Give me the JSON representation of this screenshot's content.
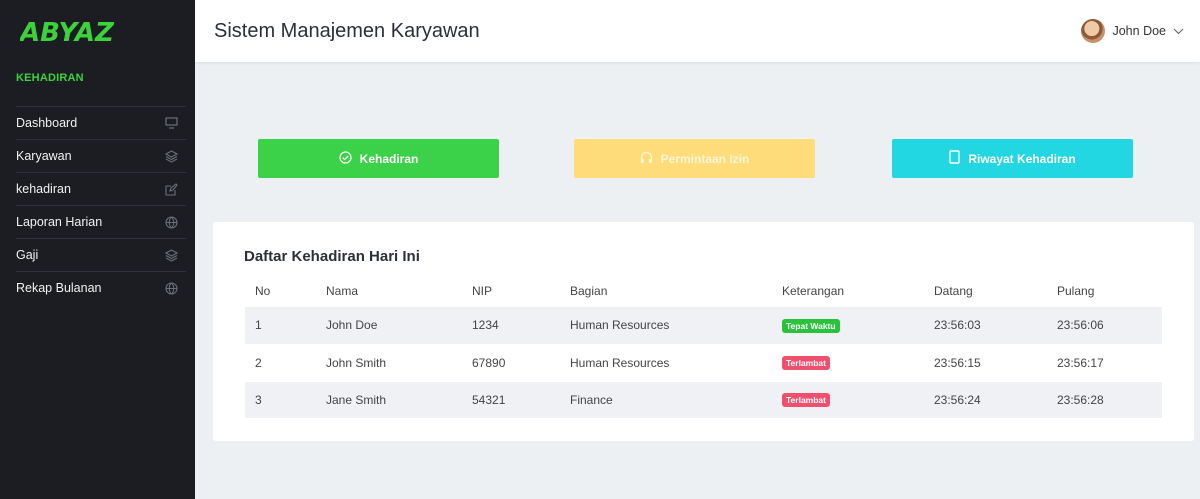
{
  "brand": {
    "logo_text": "ABYAZ"
  },
  "sidebar": {
    "section_label": "KEHADIRAN",
    "items": [
      {
        "label": "Dashboard",
        "icon": "monitor-icon"
      },
      {
        "label": "Karyawan",
        "icon": "layers-icon"
      },
      {
        "label": "kehadiran",
        "icon": "edit-icon"
      },
      {
        "label": "Laporan Harian",
        "icon": "globe-icon"
      },
      {
        "label": "Gaji",
        "icon": "layers-icon"
      },
      {
        "label": "Rekap Bulanan",
        "icon": "globe-icon"
      }
    ]
  },
  "header": {
    "title": "Sistem Manajemen Karyawan",
    "user_name": "John Doe"
  },
  "actions": {
    "kehadiran": "Kehadiran",
    "permintaan_izin": "Permintaan Izin",
    "riwayat_kehadiran": "Riwayat Kehadiran"
  },
  "attendance": {
    "title": "Daftar Kehadiran Hari Ini",
    "columns": [
      "No",
      "Nama",
      "NIP",
      "Bagian",
      "Keterangan",
      "Datang",
      "Pulang"
    ],
    "rows": [
      {
        "no": "1",
        "nama": "John Doe",
        "nip": "1234",
        "bagian": "Human Resources",
        "keterangan": "Tepat Waktu",
        "status": "ok",
        "datang": "23:56:03",
        "pulang": "23:56:06"
      },
      {
        "no": "2",
        "nama": "John Smith",
        "nip": "67890",
        "bagian": "Human Resources",
        "keterangan": "Terlambat",
        "status": "late",
        "datang": "23:56:15",
        "pulang": "23:56:17"
      },
      {
        "no": "3",
        "nama": "Jane Smith",
        "nip": "54321",
        "bagian": "Finance",
        "keterangan": "Terlambat",
        "status": "late",
        "datang": "23:56:24",
        "pulang": "23:56:28"
      }
    ]
  },
  "colors": {
    "sidebar_bg": "#1b1d22",
    "accent_green": "#3bd149",
    "accent_yellow": "#fddc79",
    "accent_cyan": "#22d6e2",
    "badge_ok": "#29c23a",
    "badge_late": "#f0506e"
  }
}
